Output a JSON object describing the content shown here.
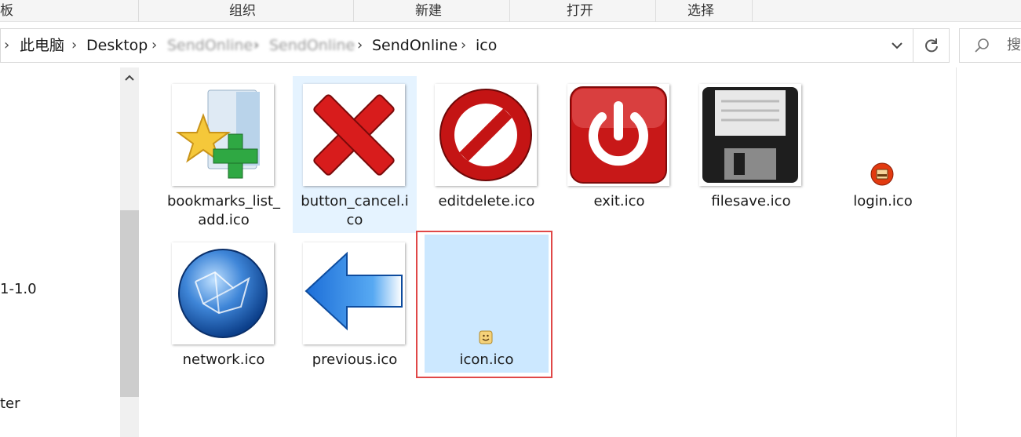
{
  "ribbon": {
    "groups": [
      "板",
      "组织",
      "新建",
      "打开",
      "选择"
    ]
  },
  "address": {
    "crumbs": [
      "此电脑",
      "Desktop",
      "SendOnline",
      "SendOnline",
      "SendOnline",
      "ico"
    ],
    "chevron_icon": "chevron-right-icon",
    "dropdown_icon": "chevron-down-icon",
    "refresh_icon": "refresh-icon"
  },
  "search": {
    "placeholder": "搜",
    "icon": "search-icon"
  },
  "nav": {
    "items": [
      "1-1.0",
      "ter"
    ]
  },
  "files": [
    {
      "name": "bookmarks_list_add.ico",
      "label_line1": "bookmarks_list_",
      "label_line2": "add.ico",
      "icon": "bookmark-add-icon"
    },
    {
      "name": "button_cancel.ico",
      "label_line1": "button_cancel.i",
      "label_line2": "co",
      "icon": "red-x-icon",
      "state": "hover"
    },
    {
      "name": "editdelete.ico",
      "label_line1": "editdelete.ico",
      "icon": "no-entry-icon"
    },
    {
      "name": "exit.ico",
      "label_line1": "exit.ico",
      "icon": "power-icon"
    },
    {
      "name": "filesave.ico",
      "label_line1": "filesave.ico",
      "icon": "floppy-disk-icon"
    },
    {
      "name": "login.ico",
      "label_line1": "login.ico",
      "icon": "login-small-icon"
    },
    {
      "name": "network.ico",
      "label_line1": "network.ico",
      "icon": "globe-network-icon"
    },
    {
      "name": "previous.ico",
      "label_line1": "previous.ico",
      "icon": "back-arrow-icon"
    },
    {
      "name": "icon.ico",
      "label_line1": "icon.ico",
      "icon": "small-smiley-icon",
      "state": "selected"
    }
  ],
  "colors": {
    "selected_bg": "#cce8ff",
    "hover_bg": "#e5f3ff",
    "annotation_frame": "#e04848"
  }
}
